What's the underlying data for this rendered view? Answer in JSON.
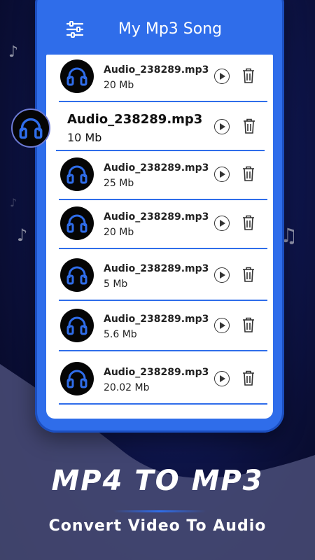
{
  "header": {
    "title": "My Mp3 Song",
    "menu_icon": "sliders-icon"
  },
  "featured": {
    "name": "Audio_238289.mp3",
    "size": "10 Mb",
    "icon": "headphones-icon"
  },
  "songs": [
    {
      "name": "Audio_238289.mp3",
      "size": "20 Mb"
    },
    {
      "name": "Audio_238289.mp3",
      "size": "25 Mb"
    },
    {
      "name": "Audio_238289.mp3",
      "size": "20 Mb"
    },
    {
      "name": "Audio_238289.mp3",
      "size": "5 Mb"
    },
    {
      "name": "Audio_238289.mp3",
      "size": "5.6 Mb"
    },
    {
      "name": "Audio_238289.mp3",
      "size": "20.02 Mb"
    }
  ],
  "promo": {
    "headline": "MP4 TO MP3",
    "subhead": "Convert Video To Audio"
  },
  "colors": {
    "accent": "#2f6dea",
    "background": "#0b0f3a",
    "headphones": "#2f6dea"
  }
}
